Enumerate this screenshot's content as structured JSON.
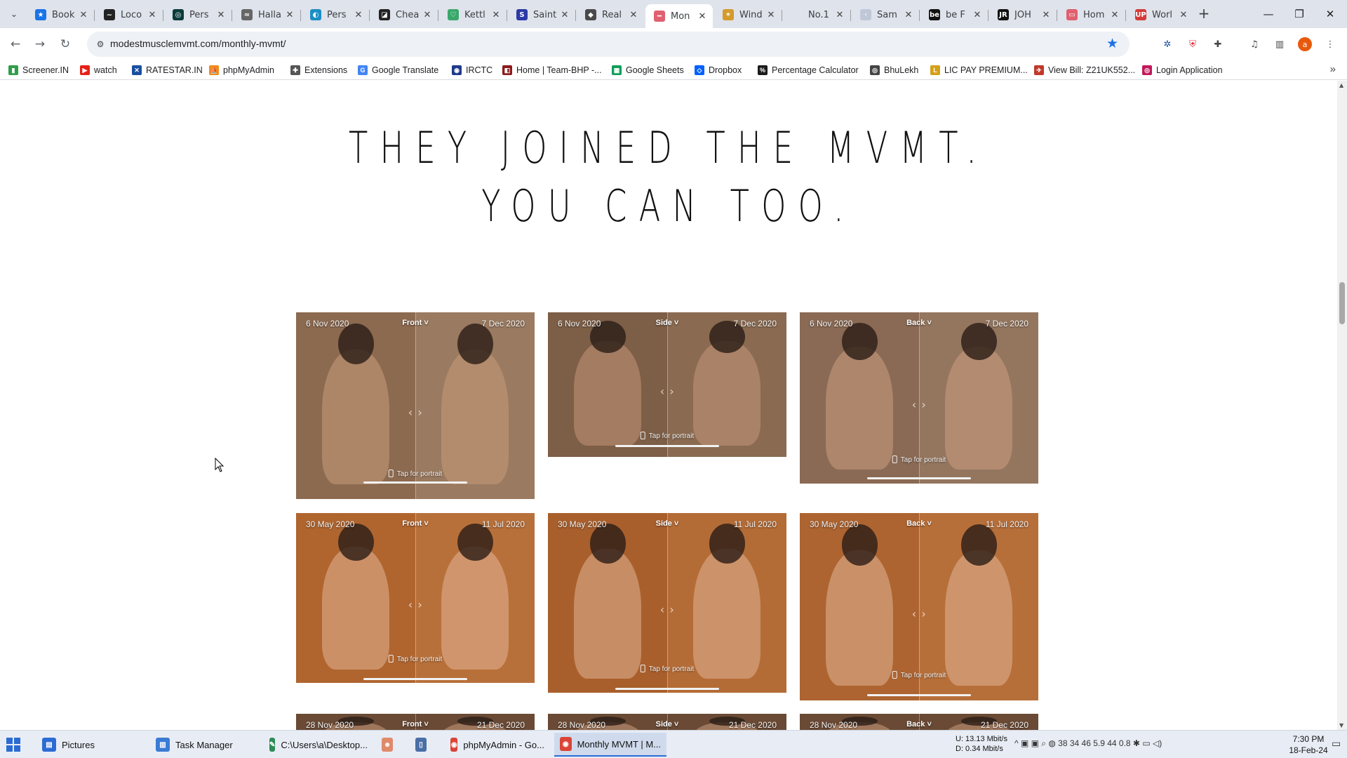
{
  "tabs": [
    {
      "title": "Book",
      "fav": "★",
      "color": "#1a73e8"
    },
    {
      "title": "Loco",
      "fav": "~",
      "color": "#222222"
    },
    {
      "title": "Pers",
      "fav": "◎",
      "color": "#0b3b3b"
    },
    {
      "title": "Halla",
      "fav": "≈",
      "color": "#666666"
    },
    {
      "title": "Pers",
      "fav": "◐",
      "color": "#1b8fc4"
    },
    {
      "title": "Chea",
      "fav": "◪",
      "color": "#222222"
    },
    {
      "title": "Kettl",
      "fav": "♡",
      "color": "#3aa86b"
    },
    {
      "title": "Saint",
      "fav": "S",
      "color": "#2b3aa6"
    },
    {
      "title": "Real",
      "fav": "◆",
      "color": "#4a4a4a"
    },
    {
      "title": "Mon",
      "fav": "━",
      "color": "#e06070"
    },
    {
      "title": "Wind",
      "fav": "✶",
      "color": "#d49a2a"
    },
    {
      "title": "No.1",
      "fav": " ",
      "color": "#dfe3eb"
    },
    {
      "title": "Sam",
      "fav": "·",
      "color": "#c0c8d8"
    },
    {
      "title": "be F",
      "fav": "be",
      "color": "#111111"
    },
    {
      "title": "JOH",
      "fav": "JR",
      "color": "#111111"
    },
    {
      "title": "Hom",
      "fav": "▭",
      "color": "#e06070"
    },
    {
      "title": "Worl",
      "fav": "UP",
      "color": "#d43a3a"
    }
  ],
  "active_tab_index": 9,
  "address": {
    "url": "modestmusclemvmt.com/monthly-mvmt/"
  },
  "bookmarks": [
    {
      "label": "Screener.IN",
      "icon": "bar-chart-icon",
      "color": "#2e9e4a",
      "glyph": "▮"
    },
    {
      "label": "watch",
      "icon": "youtube-icon",
      "color": "#e62117",
      "glyph": "▶"
    },
    {
      "label": "RATESTAR.IN",
      "icon": "ratestar-icon",
      "color": "#1a4ea0",
      "glyph": "✕"
    },
    {
      "label": "phpMyAdmin",
      "icon": "phpmyadmin-icon",
      "color": "#f28a1b",
      "glyph": "⛵"
    },
    {
      "label": "Extensions",
      "icon": "puzzle-icon",
      "color": "#555555",
      "glyph": "✚"
    },
    {
      "label": "Google Translate",
      "icon": "translate-icon",
      "color": "#4285f4",
      "glyph": "G"
    },
    {
      "label": "IRCTC",
      "icon": "irctc-icon",
      "color": "#1e3a8a",
      "glyph": "◉"
    },
    {
      "label": "Home | Team-BHP -...",
      "icon": "teambhp-icon",
      "color": "#8b1a1a",
      "glyph": "◧"
    },
    {
      "label": "Google Sheets",
      "icon": "sheets-icon",
      "color": "#0f9d58",
      "glyph": "▦"
    },
    {
      "label": "Dropbox",
      "icon": "dropbox-icon",
      "color": "#0061fe",
      "glyph": "◇"
    },
    {
      "label": "Percentage Calculator",
      "icon": "calculator-icon",
      "color": "#1a1a1a",
      "glyph": "%"
    },
    {
      "label": "BhuLekh",
      "icon": "bhulekh-icon",
      "color": "#444444",
      "glyph": "◎"
    },
    {
      "label": "LIC PAY PREMIUM...",
      "icon": "lic-icon",
      "color": "#d4a017",
      "glyph": "L"
    },
    {
      "label": "View Bill: Z21UK552...",
      "icon": "bill-icon",
      "color": "#c0392b",
      "glyph": "✈"
    },
    {
      "label": "Login Application",
      "icon": "login-icon",
      "color": "#c2185b",
      "glyph": "◎"
    }
  ],
  "page": {
    "headline_line1": "THEY JOINED THE MVMT.",
    "headline_line2": "YOU CAN TOO."
  },
  "cards": [
    {
      "before": "6 Nov 2020",
      "view": "Front ˅",
      "after": "7 Dec 2020",
      "tap": "Tap for portrait",
      "bg_left": "#8c6a50",
      "bg_right": "#9a7a60",
      "skin": "#c99a7a"
    },
    {
      "before": "6 Nov 2020",
      "view": "Side ˅",
      "after": "7 Dec 2020",
      "tap": "Tap for portrait",
      "bg_left": "#7d5e46",
      "bg_right": "#8a6b52",
      "skin": "#c49578"
    },
    {
      "before": "6 Nov 2020",
      "view": "Back ˅",
      "after": "7 Dec 2020",
      "tap": "Tap for portrait",
      "bg_left": "#8a6a54",
      "bg_right": "#94765f",
      "skin": "#cc9d80"
    },
    {
      "before": "30 May 2020",
      "view": "Front ˅",
      "after": "11 Jul 2020",
      "tap": "Tap for portrait",
      "bg_left": "#b0652f",
      "bg_right": "#b8703a",
      "skin": "#e3b596"
    },
    {
      "before": "30 May 2020",
      "view": "Side ˅",
      "after": "11 Jul 2020",
      "tap": "Tap for portrait",
      "bg_left": "#a95f2c",
      "bg_right": "#b46c36",
      "skin": "#e0b293"
    },
    {
      "before": "30 May 2020",
      "view": "Back ˅",
      "after": "11 Jul 2020",
      "tap": "Tap for portrait",
      "bg_left": "#ad6431",
      "bg_right": "#b76f3a",
      "skin": "#e2b495"
    },
    {
      "before": "28 Nov 2020",
      "view": "Front ˅",
      "after": "21 Dec 2020",
      "tap": "",
      "bg_left": "#6a4a35",
      "bg_right": "#6a4a35",
      "skin": "#c99a7a"
    },
    {
      "before": "28 Nov 2020",
      "view": "Side ˅",
      "after": "21 Dec 2020",
      "tap": "",
      "bg_left": "#6a4a35",
      "bg_right": "#6a4a35",
      "skin": "#c99a7a"
    },
    {
      "before": "28 Nov 2020",
      "view": "Back ˅",
      "after": "21 Dec 2020",
      "tap": "",
      "bg_left": "#6a4a35",
      "bg_right": "#6a4a35",
      "skin": "#c99a7a"
    }
  ],
  "taskbar": {
    "apps": [
      {
        "label": "Pictures",
        "color": "#2b6cd4",
        "glyph": "▤",
        "name": "pictures-icon"
      },
      {
        "label": "Task Manager",
        "color": "#3a7bd5",
        "glyph": "▥",
        "name": "task-manager-icon"
      },
      {
        "label": "C:\\Users\\a\\Desktop...",
        "color": "#2e8b57",
        "glyph": "✎",
        "name": "notepad-icon"
      },
      {
        "label": "",
        "color": "#e08a6a",
        "glyph": "☻",
        "name": "app-icon"
      },
      {
        "label": "",
        "color": "#4a6fa5",
        "glyph": "▯",
        "name": "document-icon"
      },
      {
        "label": "phpMyAdmin - Go...",
        "color": "#db4437",
        "glyph": "◉",
        "name": "chrome-icon"
      },
      {
        "label": "Monthly MVMT | M...",
        "color": "#db4437",
        "glyph": "◉",
        "name": "chrome-icon"
      }
    ],
    "net_up": "U:   13.13 Mbit/s",
    "net_down": "D:    0.34 Mbit/s",
    "tray": "^  ▣  ▣  ⌕  ◍  38  34  46  5.9  44  0.8  ✱  ▭  ◁)",
    "time": "7:30 PM",
    "date": "18-Feb-24"
  }
}
